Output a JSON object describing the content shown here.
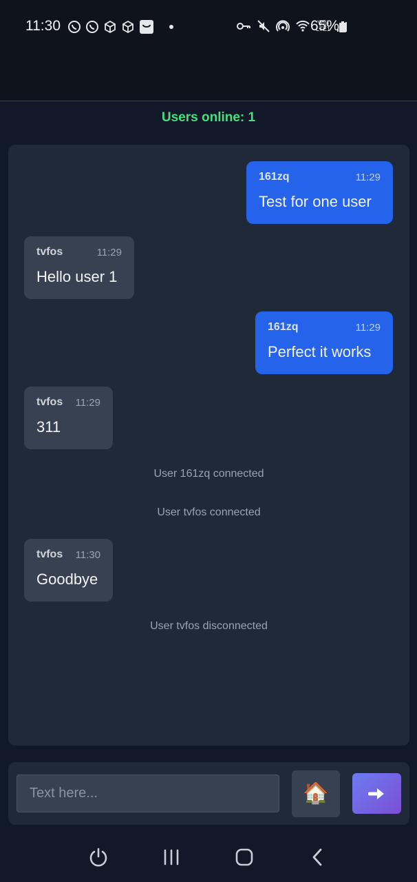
{
  "statusbar": {
    "time": "11:30",
    "battery": "65%",
    "icons_left": [
      "whatsapp-icon",
      "whatsapp-icon",
      "box-icon",
      "box-icon",
      "shopping-bag-icon",
      "dot-icon"
    ],
    "icons_right": [
      "key-icon",
      "mute-icon",
      "hotspot-icon",
      "wifi-icon",
      "volte-icon",
      "signal-icon",
      "battery-icon"
    ],
    "volte_line1": "Vo))",
    "volte_line2": "LTE1"
  },
  "online_label": "Users online: 1",
  "messages": [
    {
      "type": "self",
      "user": "161zq",
      "time": "11:29",
      "text": "Test for one user"
    },
    {
      "type": "other",
      "user": "tvfos",
      "time": "11:29",
      "text": "Hello user 1"
    },
    {
      "type": "self",
      "user": "161zq",
      "time": "11:29",
      "text": "Perfect it works"
    },
    {
      "type": "other",
      "user": "tvfos",
      "time": "11:29",
      "text": "311"
    },
    {
      "type": "system",
      "text": "User 161zq connected"
    },
    {
      "type": "system",
      "text": "User tvfos connected"
    },
    {
      "type": "other",
      "user": "tvfos",
      "time": "11:30",
      "text": "Goodbye"
    },
    {
      "type": "system",
      "text": "User tvfos disconnected"
    }
  ],
  "composer": {
    "placeholder": "Text here...",
    "home_icon": "🏠",
    "send_icon": "➜"
  },
  "navbar": [
    "power-icon",
    "recents-icon",
    "home-icon",
    "back-icon"
  ],
  "colors": {
    "background": "#111827",
    "panel": "#1f2937",
    "self_bubble": "#2563eb",
    "other_bubble": "#374151",
    "online": "#4ade80"
  }
}
